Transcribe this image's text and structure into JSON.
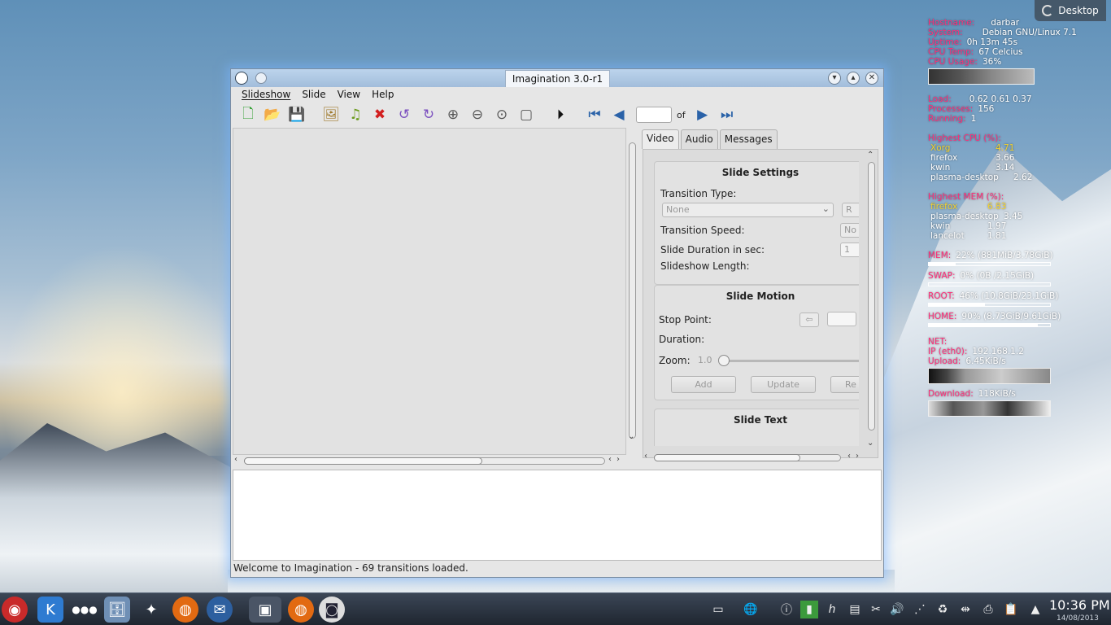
{
  "desktop": {
    "label": "Desktop"
  },
  "conky": {
    "hostname_k": "Hostname:",
    "hostname_v": "darbar",
    "system_k": "System:",
    "system_v": "Debian GNU/Linux 7.1",
    "uptime_k": "Uptime:",
    "uptime_v": "0h 13m 45s",
    "cputemp_k": "CPU Temp:",
    "cputemp_v": "67 Celcius",
    "cpuusage_k": "CPU Usage:",
    "cpuusage_v": "36%",
    "load_k": "Load:",
    "load_v": "0.62 0.61 0.37",
    "processes_k": "Processes:",
    "processes_v": "156",
    "running_k": "Running:",
    "running_v": "1",
    "highcpu_title": "Highest CPU (%):",
    "highcpu": [
      {
        "name": "Xorg",
        "value": "4.71"
      },
      {
        "name": "firefox",
        "value": "3.66"
      },
      {
        "name": "kwin",
        "value": "3.14"
      },
      {
        "name": "plasma-desktop",
        "value": "2.62"
      }
    ],
    "highmem_title": "Highest MEM (%):",
    "highmem": [
      {
        "name": "firefox",
        "value": "6.83"
      },
      {
        "name": "plasma-desktop",
        "value": "3.45"
      },
      {
        "name": "kwin",
        "value": "1.97"
      },
      {
        "name": "lancelot",
        "value": "1.81"
      }
    ],
    "mem_k": "MEM:",
    "mem_v": "22% (881MiB/3.78GiB)",
    "mem_pct": 22,
    "swap_k": "SWAP:",
    "swap_v": "0% (0B  /2.15GiB)",
    "swap_pct": 0,
    "root_k": "ROOT:",
    "root_v": "46% (10.8GiB/23.1GiB)",
    "root_pct": 46,
    "home_k": "HOME:",
    "home_v": "90% (8.73GiB/9.61GiB)",
    "home_pct": 90,
    "net_title": "NET:",
    "ip_k": "IP (eth0):",
    "ip_v": "192.168.1.2",
    "upload_k": "Upload:",
    "upload_v": "6.45KiB/s",
    "download_k": "Download:",
    "download_v": "118KiB/s"
  },
  "window": {
    "title": "Imagination 3.0-r1",
    "menus": [
      "Slideshow",
      "Slide",
      "View",
      "Help"
    ],
    "slide_of": "of",
    "tabs": [
      "Video",
      "Audio",
      "Messages"
    ],
    "slide_settings": {
      "heading": "Slide Settings",
      "transition_type_label": "Transition Type:",
      "transition_type_value": "None",
      "transition_random_btn": "R",
      "transition_speed_label": "Transition Speed:",
      "transition_speed_value": "No",
      "duration_label": "Slide Duration in sec:",
      "duration_value": "1",
      "length_label": "Slideshow Length:"
    },
    "slide_motion": {
      "heading": "Slide Motion",
      "stop_point_label": "Stop Point:",
      "duration_label": "Duration:",
      "zoom_label": "Zoom:",
      "zoom_value": "1.0",
      "add": "Add",
      "update": "Update",
      "remove": "Re"
    },
    "slide_text": {
      "heading": "Slide Text"
    },
    "status": "Welcome to Imagination - 69 transitions loaded."
  },
  "taskbar": {
    "time": "10:36 PM",
    "date": "14/08/2013"
  },
  "colors": {
    "accent_pink": "#ff2e7a",
    "highlight_yellow": "#f3d22f",
    "titlebar": "#a2bddb"
  }
}
